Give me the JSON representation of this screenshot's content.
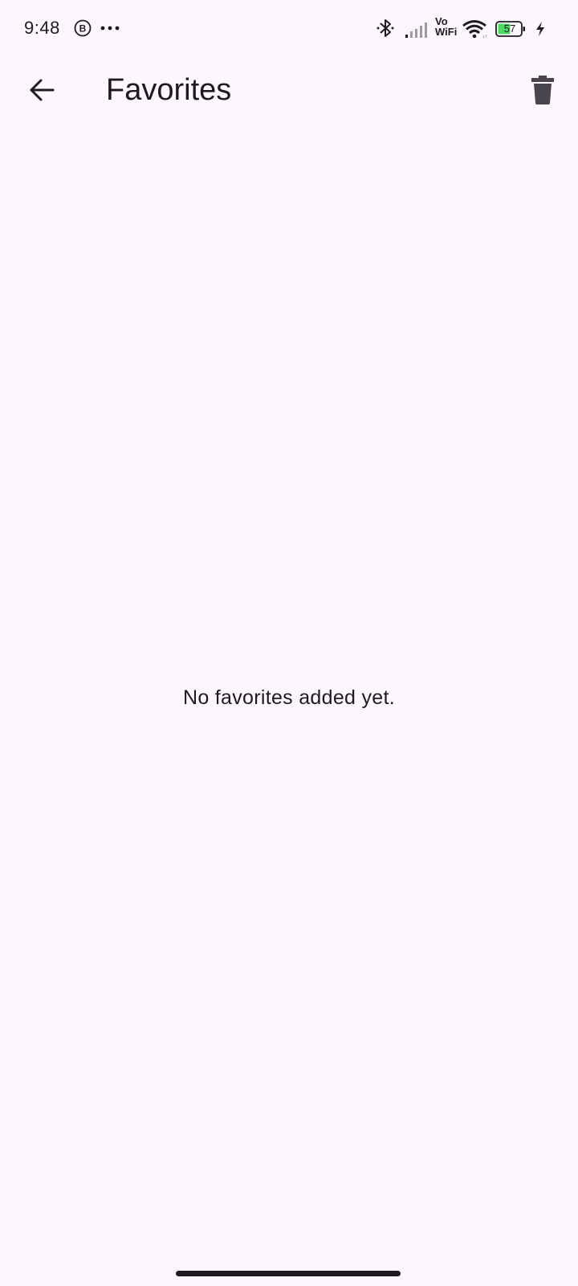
{
  "status_bar": {
    "time": "9:48",
    "battery_level": "57",
    "vowifi_top": "Vo",
    "vowifi_bottom": "WiFi"
  },
  "app_bar": {
    "title": "Favorites"
  },
  "main": {
    "empty_message": "No favorites added yet."
  },
  "icons": {
    "back": "arrow-back-icon",
    "delete": "trash-icon",
    "bluetooth": "bluetooth-icon",
    "wifi": "wifi-icon",
    "signal": "signal-icon",
    "battery": "battery-icon"
  },
  "colors": {
    "background": "#fdf7fd",
    "text": "#1d1b20",
    "battery_fill": "#4cd964",
    "icon_dark": "#49454f"
  }
}
